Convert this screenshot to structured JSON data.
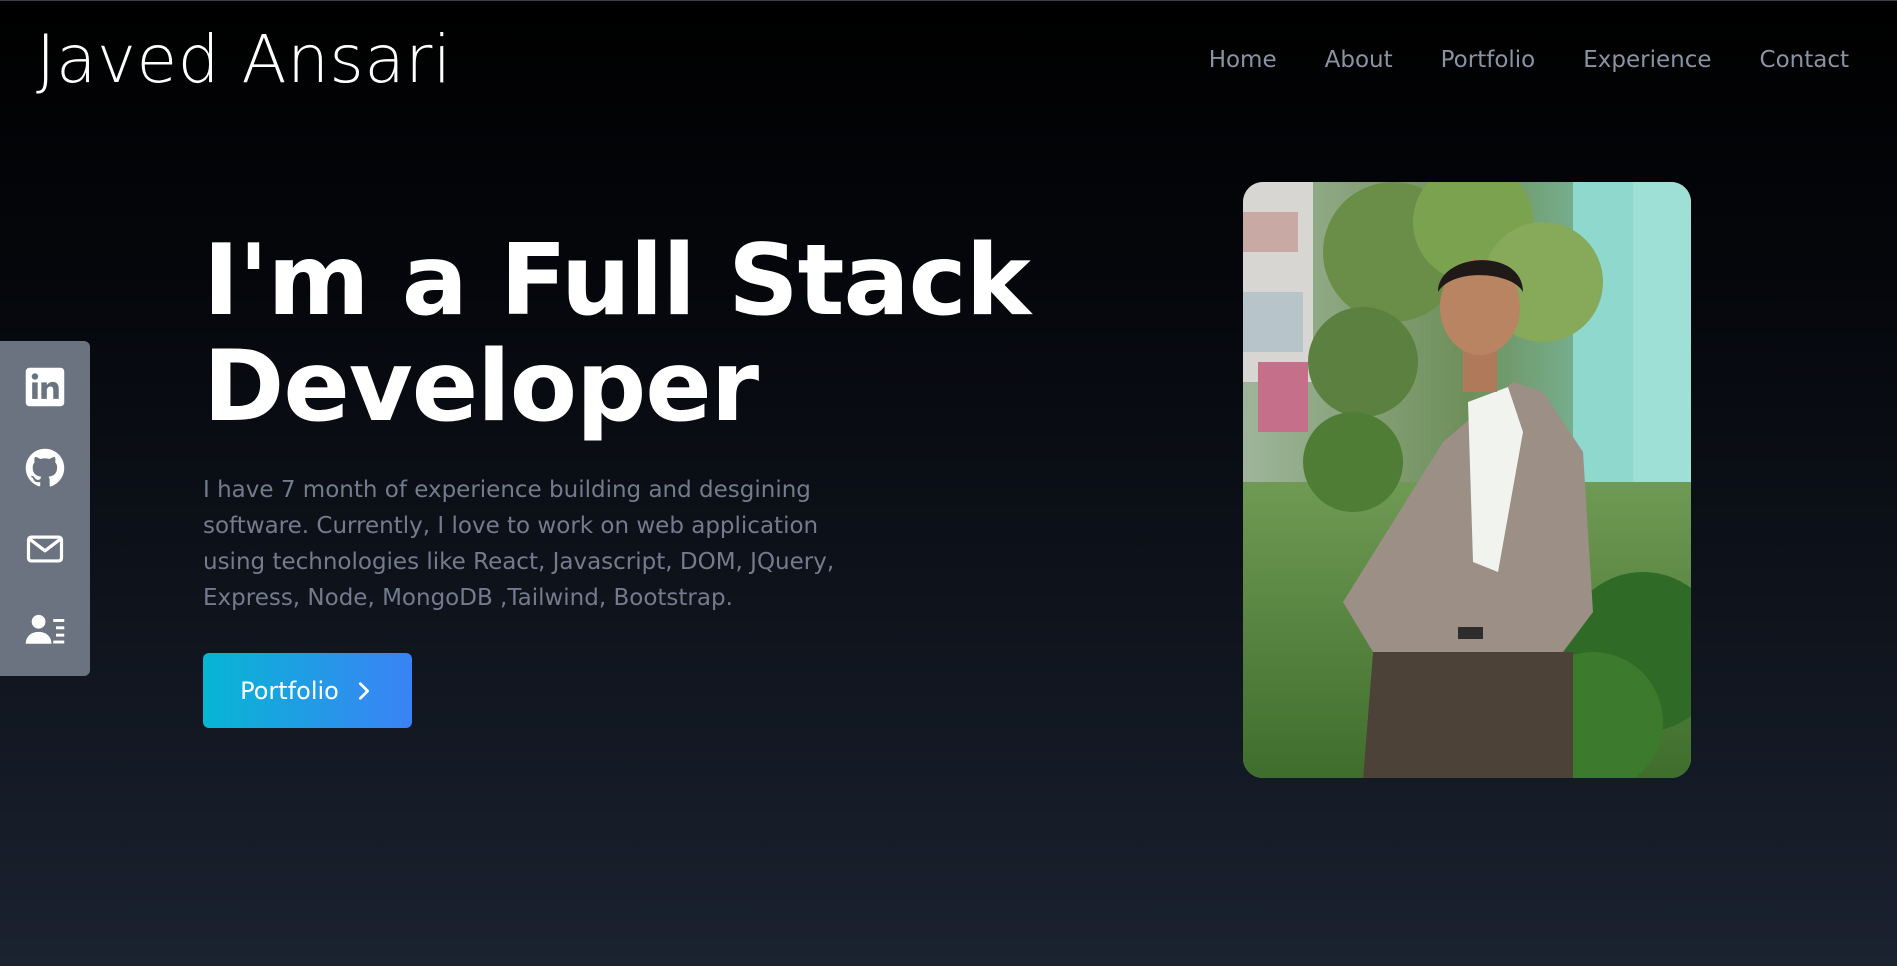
{
  "header": {
    "brand": "Javed Ansari",
    "nav": [
      "Home",
      "About",
      "Portfolio",
      "Experience",
      "Contact"
    ]
  },
  "social": [
    {
      "icon": "linkedin-icon"
    },
    {
      "icon": "github-icon"
    },
    {
      "icon": "mail-icon"
    },
    {
      "icon": "resume-icon"
    }
  ],
  "hero": {
    "title_line1": "I'm a Full Stack",
    "title_line2": "Developer",
    "description": "I have 7 month of experience building and desgining software. Currently, I love to work on web application using technologies like React, Javascript, DOM, JQuery, Express, Node, MongoDB ,Tailwind, Bootstrap.",
    "cta_label": "Portfolio",
    "cta_icon": "chevron-right-icon"
  },
  "colors": {
    "accent_start": "#06b6d4",
    "accent_end": "#3b82f6",
    "social_bar": "#6b7280",
    "muted_text": "#737b8c",
    "nav_text": "#8a93a4"
  }
}
